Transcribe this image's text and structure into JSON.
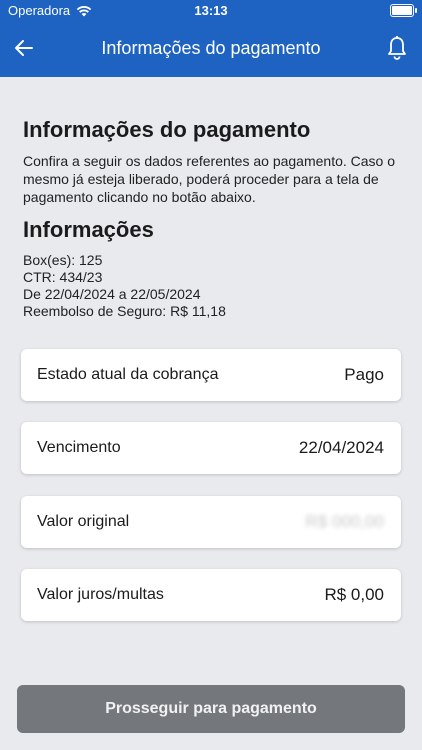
{
  "status_bar": {
    "carrier": "Operadora",
    "time": "13:13"
  },
  "nav": {
    "title": "Informações do pagamento",
    "back_icon": "arrow-left-icon",
    "bell_icon": "bell-icon"
  },
  "page": {
    "title": "Informações do pagamento",
    "description": "Confira a seguir os dados referentes ao pagamento. Caso o mesmo já esteja liberado, poderá proceder para a tela de pagamento clicando no botão abaixo.",
    "info_title": "Informações",
    "info_lines": [
      "Box(es): 125",
      "CTR: 434/23",
      "De 22/04/2024 a 22/05/2024",
      "Reembolso de Seguro: R$ 11,18"
    ]
  },
  "cards": [
    {
      "label": "Estado atual da cobrança",
      "value": "Pago"
    },
    {
      "label": "Vencimento",
      "value": "22/04/2024"
    },
    {
      "label": "Valor original",
      "value": "R$ 000,00"
    },
    {
      "label": "Valor juros/multas",
      "value": "R$ 0,00"
    }
  ],
  "cta": {
    "label": "Prosseguir para pagamento"
  },
  "colors": {
    "primary": "#1e63c2",
    "background": "#e8eaee",
    "button_disabled": "#74787d"
  }
}
